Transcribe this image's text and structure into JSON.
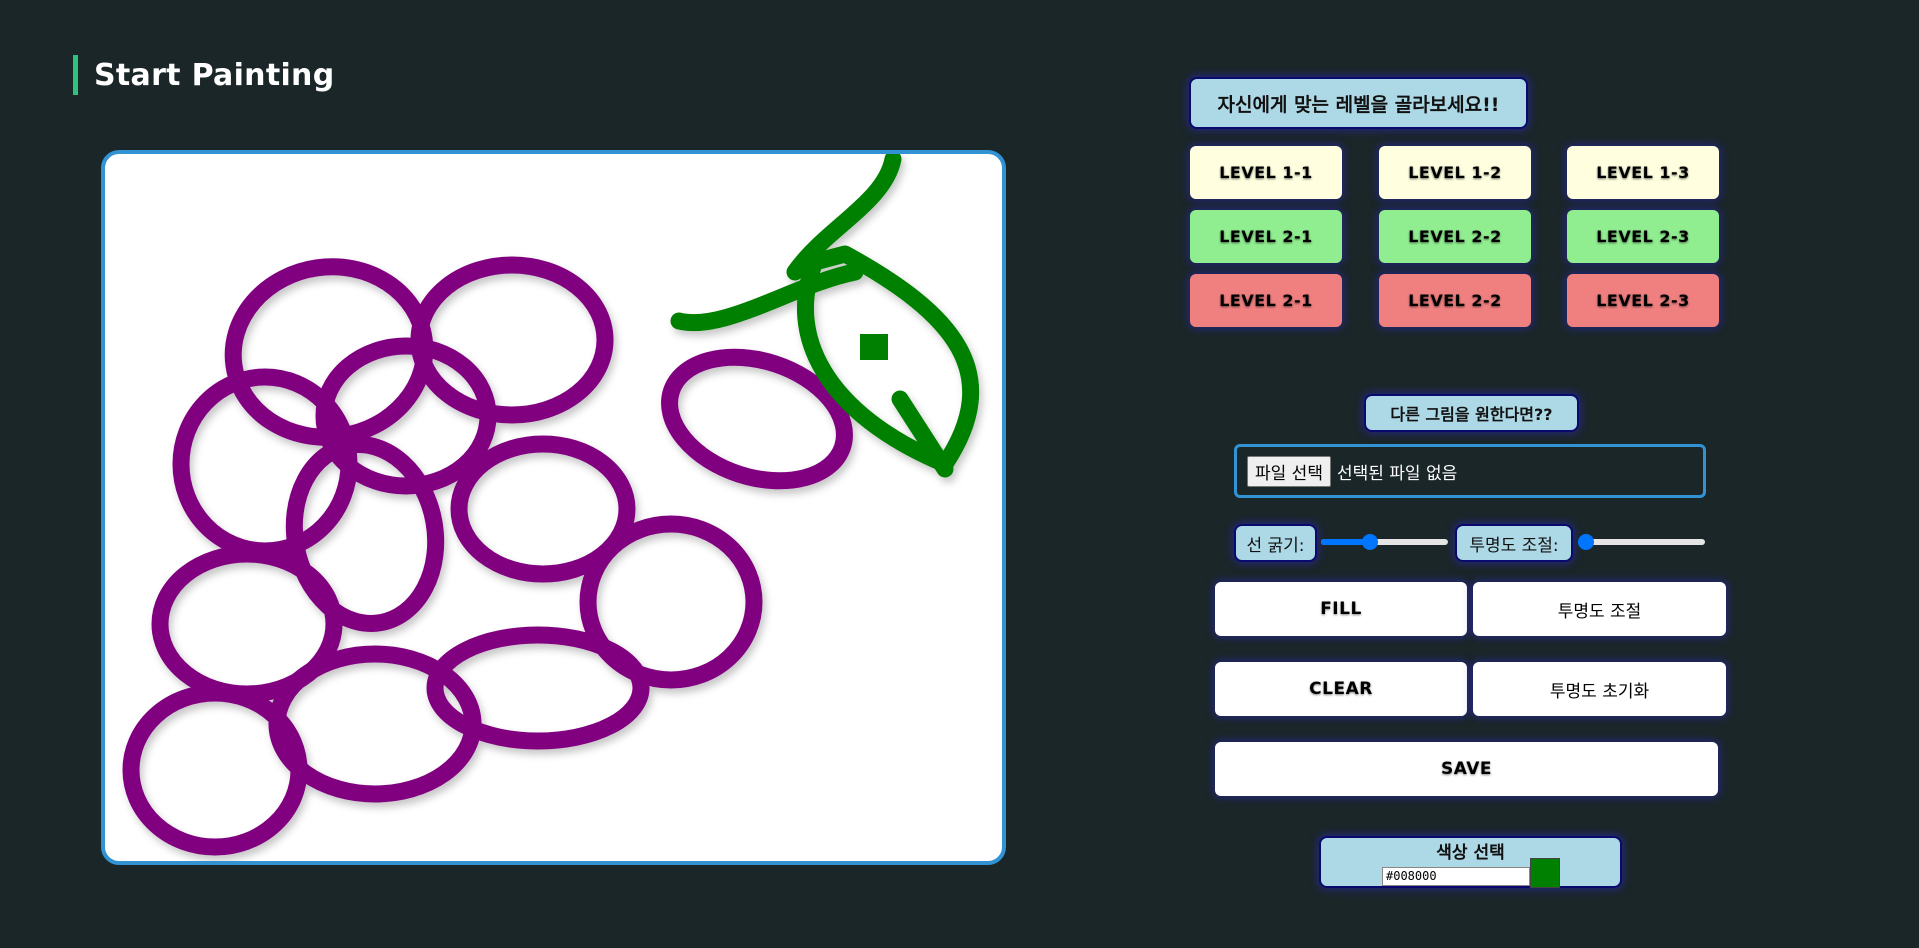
{
  "header": {
    "title": "Start Painting"
  },
  "level_prompt": "자신에게 맞는 레벨을 골라보세요!!",
  "levels": [
    {
      "label": "LEVEL 1-1",
      "tone": "yellow"
    },
    {
      "label": "LEVEL 1-2",
      "tone": "yellow"
    },
    {
      "label": "LEVEL 1-3",
      "tone": "yellow"
    },
    {
      "label": "LEVEL 2-1",
      "tone": "green"
    },
    {
      "label": "LEVEL 2-2",
      "tone": "green"
    },
    {
      "label": "LEVEL 2-3",
      "tone": "green"
    },
    {
      "label": "LEVEL 2-1",
      "tone": "red"
    },
    {
      "label": "LEVEL 2-2",
      "tone": "red"
    },
    {
      "label": "LEVEL 2-3",
      "tone": "red"
    }
  ],
  "upload": {
    "prompt": "다른 그림을 원한다면??",
    "button_label": "파일 선택",
    "status": "선택된 파일 없음"
  },
  "controls": {
    "line_width_label": "선 굵기:",
    "line_width_value": 0.37,
    "opacity_label": "투명도 조절:",
    "opacity_value": 0.0
  },
  "buttons": {
    "fill": "FILL",
    "opacity_adjust": "투명도 조절",
    "clear": "CLEAR",
    "opacity_reset": "투명도 초기화",
    "save": "SAVE"
  },
  "color_picker": {
    "label": "색상 선택",
    "value": "#008000"
  },
  "colors": {
    "background": "#1b2629",
    "accent": "#2ec27e",
    "canvas_border": "#3192d4",
    "grape": "#800080",
    "leaf": "#008000",
    "level_yellow": "#ffffe0",
    "level_green": "#90ee90",
    "level_red": "#f08080",
    "pill": "#add8e6"
  }
}
